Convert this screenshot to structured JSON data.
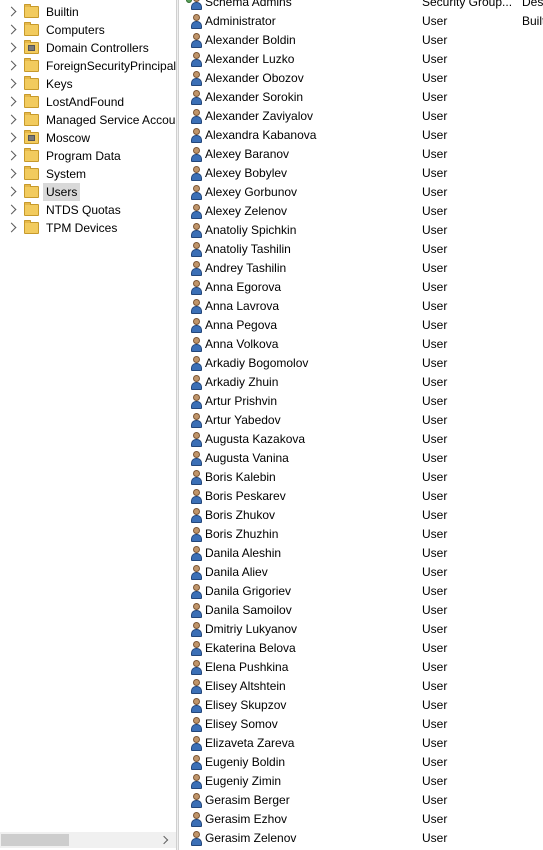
{
  "tree": {
    "items": [
      {
        "label": "Builtin",
        "kind": "container",
        "selected": false
      },
      {
        "label": "Computers",
        "kind": "container",
        "selected": false
      },
      {
        "label": "Domain Controllers",
        "kind": "ou",
        "selected": false
      },
      {
        "label": "ForeignSecurityPrincipals",
        "kind": "container",
        "selected": false
      },
      {
        "label": "Keys",
        "kind": "container",
        "selected": false
      },
      {
        "label": "LostAndFound",
        "kind": "container",
        "selected": false
      },
      {
        "label": "Managed Service Accounts",
        "kind": "container",
        "selected": false
      },
      {
        "label": "Moscow",
        "kind": "ou",
        "selected": false
      },
      {
        "label": "Program Data",
        "kind": "container",
        "selected": false
      },
      {
        "label": "System",
        "kind": "container",
        "selected": false
      },
      {
        "label": "Users",
        "kind": "container",
        "selected": true
      },
      {
        "label": "NTDS Quotas",
        "kind": "container",
        "selected": false
      },
      {
        "label": "TPM Devices",
        "kind": "container",
        "selected": false
      }
    ]
  },
  "list": {
    "rows": [
      {
        "name": "Schema Admins",
        "type": "Security Group...",
        "description": "Desi",
        "icon": "group-icon"
      },
      {
        "name": "Administrator",
        "type": "User",
        "description": "Built",
        "icon": "user-icon"
      },
      {
        "name": "Alexander Boldin",
        "type": "User",
        "description": "",
        "icon": "user-icon"
      },
      {
        "name": "Alexander Luzko",
        "type": "User",
        "description": "",
        "icon": "user-icon"
      },
      {
        "name": "Alexander Obozov",
        "type": "User",
        "description": "",
        "icon": "user-icon"
      },
      {
        "name": "Alexander Sorokin",
        "type": "User",
        "description": "",
        "icon": "user-icon"
      },
      {
        "name": "Alexander Zaviyalov",
        "type": "User",
        "description": "",
        "icon": "user-icon"
      },
      {
        "name": "Alexandra Kabanova",
        "type": "User",
        "description": "",
        "icon": "user-icon"
      },
      {
        "name": "Alexey Baranov",
        "type": "User",
        "description": "",
        "icon": "user-icon"
      },
      {
        "name": "Alexey Bobylev",
        "type": "User",
        "description": "",
        "icon": "user-icon"
      },
      {
        "name": "Alexey Gorbunov",
        "type": "User",
        "description": "",
        "icon": "user-icon"
      },
      {
        "name": "Alexey Zelenov",
        "type": "User",
        "description": "",
        "icon": "user-icon"
      },
      {
        "name": "Anatoliy Spichkin",
        "type": "User",
        "description": "",
        "icon": "user-icon"
      },
      {
        "name": "Anatoliy Tashilin",
        "type": "User",
        "description": "",
        "icon": "user-icon"
      },
      {
        "name": "Andrey Tashilin",
        "type": "User",
        "description": "",
        "icon": "user-icon"
      },
      {
        "name": "Anna Egorova",
        "type": "User",
        "description": "",
        "icon": "user-icon"
      },
      {
        "name": "Anna Lavrova",
        "type": "User",
        "description": "",
        "icon": "user-icon"
      },
      {
        "name": "Anna Pegova",
        "type": "User",
        "description": "",
        "icon": "user-icon"
      },
      {
        "name": "Anna Volkova",
        "type": "User",
        "description": "",
        "icon": "user-icon"
      },
      {
        "name": "Arkadiy Bogomolov",
        "type": "User",
        "description": "",
        "icon": "user-icon"
      },
      {
        "name": "Arkadiy Zhuin",
        "type": "User",
        "description": "",
        "icon": "user-icon"
      },
      {
        "name": "Artur Prishvin",
        "type": "User",
        "description": "",
        "icon": "user-icon"
      },
      {
        "name": "Artur Yabedov",
        "type": "User",
        "description": "",
        "icon": "user-icon"
      },
      {
        "name": "Augusta Kazakova",
        "type": "User",
        "description": "",
        "icon": "user-icon"
      },
      {
        "name": "Augusta Vanina",
        "type": "User",
        "description": "",
        "icon": "user-icon"
      },
      {
        "name": "Boris Kalebin",
        "type": "User",
        "description": "",
        "icon": "user-icon"
      },
      {
        "name": "Boris Peskarev",
        "type": "User",
        "description": "",
        "icon": "user-icon"
      },
      {
        "name": "Boris Zhukov",
        "type": "User",
        "description": "",
        "icon": "user-icon"
      },
      {
        "name": "Boris Zhuzhin",
        "type": "User",
        "description": "",
        "icon": "user-icon"
      },
      {
        "name": "Danila Aleshin",
        "type": "User",
        "description": "",
        "icon": "user-icon"
      },
      {
        "name": "Danila Aliev",
        "type": "User",
        "description": "",
        "icon": "user-icon"
      },
      {
        "name": "Danila Grigoriev",
        "type": "User",
        "description": "",
        "icon": "user-icon"
      },
      {
        "name": "Danila Samoilov",
        "type": "User",
        "description": "",
        "icon": "user-icon"
      },
      {
        "name": "Dmitriy Lukyanov",
        "type": "User",
        "description": "",
        "icon": "user-icon"
      },
      {
        "name": "Ekaterina Belova",
        "type": "User",
        "description": "",
        "icon": "user-icon"
      },
      {
        "name": "Elena Pushkina",
        "type": "User",
        "description": "",
        "icon": "user-icon"
      },
      {
        "name": "Elisey Altshtein",
        "type": "User",
        "description": "",
        "icon": "user-icon"
      },
      {
        "name": "Elisey Skupzov",
        "type": "User",
        "description": "",
        "icon": "user-icon"
      },
      {
        "name": "Elisey Somov",
        "type": "User",
        "description": "",
        "icon": "user-icon"
      },
      {
        "name": "Elizaveta Zareva",
        "type": "User",
        "description": "",
        "icon": "user-icon"
      },
      {
        "name": "Eugeniy Boldin",
        "type": "User",
        "description": "",
        "icon": "user-icon"
      },
      {
        "name": "Eugeniy Zimin",
        "type": "User",
        "description": "",
        "icon": "user-icon"
      },
      {
        "name": "Gerasim Berger",
        "type": "User",
        "description": "",
        "icon": "user-icon"
      },
      {
        "name": "Gerasim Ezhov",
        "type": "User",
        "description": "",
        "icon": "user-icon"
      },
      {
        "name": "Gerasim Zelenov",
        "type": "User",
        "description": "",
        "icon": "user-icon"
      }
    ]
  },
  "colors": {
    "selection": "#d9d9d9",
    "folder": "#f2cb5e",
    "scrollbar_thumb": "#cdcdcd"
  },
  "icons": {
    "tree_expand": "chevron-right-icon",
    "scroll_right": "scroll-right-arrow-icon"
  }
}
